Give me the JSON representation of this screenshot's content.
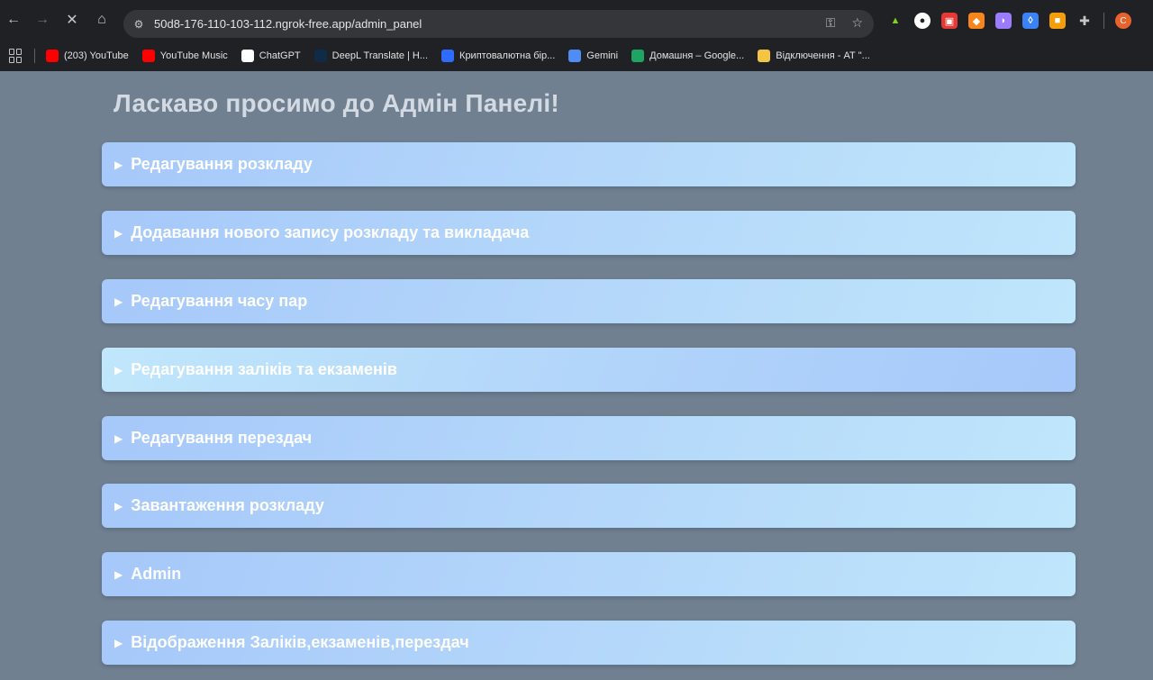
{
  "browser": {
    "url": "50d8-176-110-103-112.ngrok-free.app/admin_panel",
    "nav_icons": [
      "back-arrow-icon",
      "forward-arrow-icon",
      "stop-loading-icon",
      "home-icon"
    ],
    "bookmarks": [
      {
        "label": "(203) YouTube",
        "icon": "youtube-icon",
        "color": "#ff0000"
      },
      {
        "label": "YouTube Music",
        "icon": "youtube-music-icon",
        "color": "#ff0000"
      },
      {
        "label": "ChatGPT",
        "icon": "chatgpt-icon",
        "color": "#ffffff"
      },
      {
        "label": "DeepL Translate | H...",
        "icon": "deepl-icon",
        "color": "#0f2b46"
      },
      {
        "label": "Криптовалютна бір...",
        "icon": "exchange-icon",
        "color": "#2f6bff"
      },
      {
        "label": "Gemini",
        "icon": "gemini-icon",
        "color": "#4f8df5"
      },
      {
        "label": "Домашня – Google...",
        "icon": "google-drive-icon",
        "color": "#1fa463"
      },
      {
        "label": "Відключення - АТ \"...",
        "icon": "power-outage-icon",
        "color": "#f4c542"
      }
    ]
  },
  "page": {
    "title": "Ласкаво просимо до Адмін Панелі!",
    "sections": [
      {
        "label": "Редагування розкладу"
      },
      {
        "label": "Додавання нового запису розкладу та викладача"
      },
      {
        "label": "Редагування часу пар"
      },
      {
        "label": "Редагування заліків та екзаменів"
      },
      {
        "label": "Редагування перездач"
      },
      {
        "label": "Завантаження розкладу"
      },
      {
        "label": "Admin"
      },
      {
        "label": "Відображення Заліків,екзаменів,перездач"
      }
    ],
    "expand_symbol": "▶"
  }
}
